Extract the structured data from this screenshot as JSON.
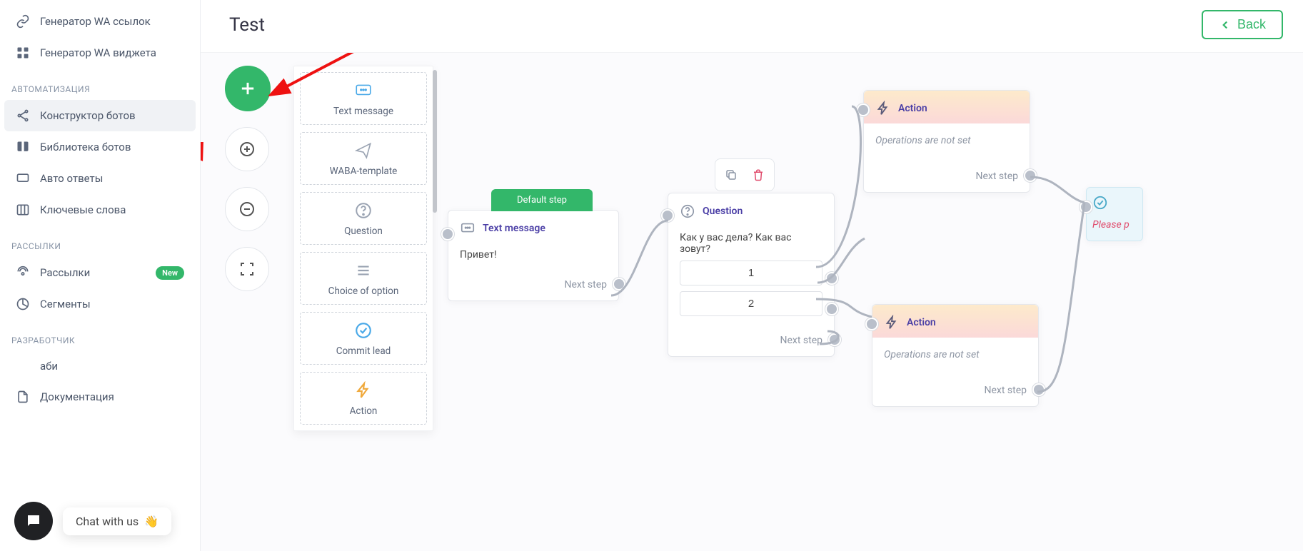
{
  "sidebar": {
    "items_top": [
      {
        "label": "Генератор WA ссылок"
      },
      {
        "label": "Генератор WA виджета"
      }
    ],
    "section_auto": "АВТОМАТИЗАЦИЯ",
    "items_auto": [
      {
        "label": "Конструктор ботов",
        "active": true
      },
      {
        "label": "Библиотека ботов"
      },
      {
        "label": "Авто ответы"
      },
      {
        "label": "Ключевые слова"
      }
    ],
    "section_mail": "РАССЫЛКИ",
    "items_mail": [
      {
        "label": "Рассылки",
        "badge": "New"
      },
      {
        "label": "Сегменты"
      }
    ],
    "section_dev": "РАЗРАБОТЧИК",
    "items_dev_partial": "аби",
    "items_dev2": "Документация"
  },
  "chat_widget": {
    "label": "Chat with us",
    "emoji": "👋"
  },
  "page": {
    "title": "Test",
    "back": "Back"
  },
  "palette": {
    "text_message": "Text message",
    "waba_template": "WABA-template",
    "question": "Question",
    "choice": "Choice of option",
    "commit_lead": "Commit lead",
    "action": "Action"
  },
  "nodes": {
    "text": {
      "default_tag": "Default step",
      "title": "Text message",
      "body": "Привет!",
      "next": "Next step"
    },
    "question": {
      "title": "Question",
      "body": "Как у вас дела? Как вас зовут?",
      "opt1": "1",
      "opt2": "2",
      "next": "Next step"
    },
    "action1": {
      "title": "Action",
      "body": "Operations are not set",
      "next": "Next step"
    },
    "action2": {
      "title": "Action",
      "body": "Operations are not set",
      "next": "Next step"
    },
    "check": {
      "warn": "Please p"
    }
  }
}
